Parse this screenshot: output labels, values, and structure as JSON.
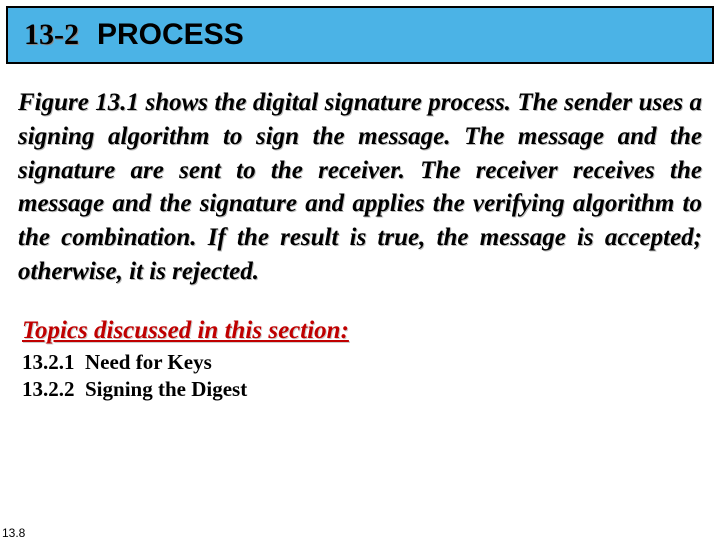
{
  "header": {
    "section_number": "13-2",
    "section_title": "PROCESS"
  },
  "body": {
    "paragraph": "Figure 13.1 shows the digital signature process. The sender uses a signing algorithm to sign the message. The message and the signature are sent to the receiver. The receiver receives the message and the signature and applies the verifying algorithm to the combination. If the result is true, the message is accepted; otherwise, it is rejected."
  },
  "topics": {
    "heading": "Topics discussed in this section:",
    "items": [
      "13.2.1  Need for Keys",
      "13.2.2  Signing the Digest"
    ]
  },
  "footer": {
    "page_number": "13.8"
  }
}
